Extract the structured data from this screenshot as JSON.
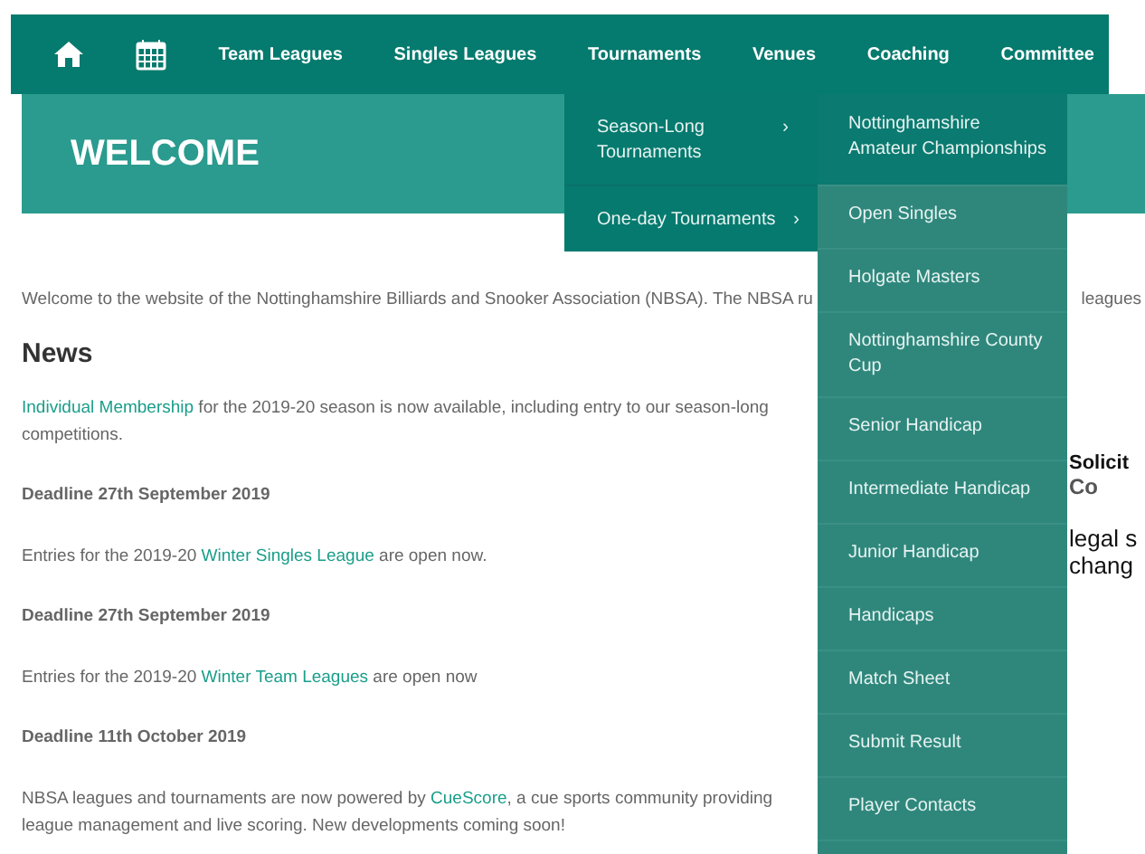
{
  "nav": {
    "items": [
      {
        "kind": "home"
      },
      {
        "kind": "calendar"
      },
      {
        "kind": "text",
        "label": "Team Leagues"
      },
      {
        "kind": "text",
        "label": "Singles Leagues"
      },
      {
        "kind": "text",
        "label": "Tournaments"
      },
      {
        "kind": "text",
        "label": "Venues"
      },
      {
        "kind": "text",
        "label": "Coaching"
      },
      {
        "kind": "text",
        "label": "Committee"
      }
    ]
  },
  "banner": {
    "title": "WELCOME"
  },
  "dropdown": {
    "items": [
      {
        "label": "Season-Long Tournaments",
        "arrow": "›"
      },
      {
        "label": "One-day Tournaments",
        "arrow": "›"
      }
    ]
  },
  "submenu": {
    "items": [
      "Nottinghamshire Amateur Championships",
      "Open Singles",
      "Holgate Masters",
      "Nottinghamshire County Cup",
      "Senior Handicap",
      "Intermediate Handicap",
      "Junior Handicap",
      "Handicaps",
      "Match Sheet",
      "Submit Result",
      "Player Contacts"
    ]
  },
  "intro": {
    "text": "Welcome to the website of the Nottinghamshire Billiards and Snooker Association (NBSA). The NBSA ru",
    "continued": "leagues"
  },
  "news": {
    "title": "News",
    "blocks": [
      {
        "kind": "paragraph",
        "parts": [
          {
            "kind": "link",
            "text": "Individual Membership"
          },
          {
            "kind": "text",
            "text": " for the 2019-20 season is now available, including entry to our season-long competitions."
          }
        ]
      },
      {
        "kind": "deadline",
        "text": "Deadline 27th September 2019"
      },
      {
        "kind": "paragraph",
        "parts": [
          {
            "kind": "text",
            "text": "Entries for the 2019-20 "
          },
          {
            "kind": "link",
            "text": "Winter Singles League"
          },
          {
            "kind": "text",
            "text": " are open now."
          }
        ]
      },
      {
        "kind": "deadline",
        "text": "Deadline 27th September 2019"
      },
      {
        "kind": "paragraph",
        "parts": [
          {
            "kind": "text",
            "text": "Entries for the 2019-20 "
          },
          {
            "kind": "link",
            "text": "Winter Team Leagues"
          },
          {
            "kind": "text",
            "text": " are open now"
          }
        ]
      },
      {
        "kind": "deadline",
        "text": "Deadline 11th October 2019"
      },
      {
        "kind": "paragraph",
        "parts": [
          {
            "kind": "text",
            "text": "NBSA leagues and tournaments are now powered by "
          },
          {
            "kind": "link",
            "text": "CueScore"
          },
          {
            "kind": "text",
            "text": ", a cue sports community providing league management and live scoring. New developments coming soon!"
          }
        ]
      }
    ]
  },
  "ad": {
    "brand": "Solicit",
    "sub": "Co",
    "line_1": "legal s",
    "line_2": "chang"
  }
}
